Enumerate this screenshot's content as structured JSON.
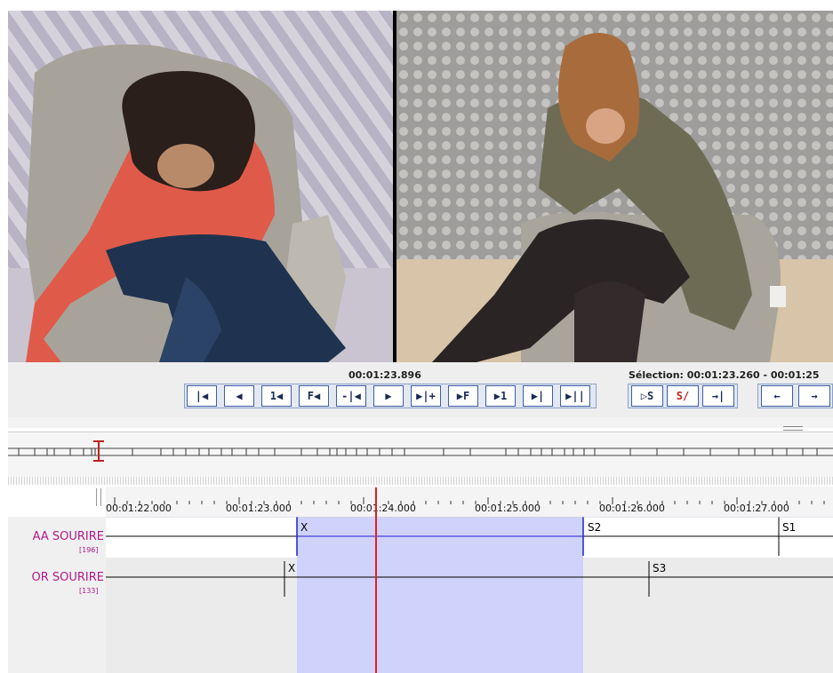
{
  "player": {
    "current_time": "00:01:23.896",
    "selection_label": "Sélection: 00:01:23.260 - 00:01:25"
  },
  "buttons": [
    {
      "id": "go-begin",
      "label": "|◀"
    },
    {
      "id": "prev-frame-step",
      "label": "◀"
    },
    {
      "id": "one-back",
      "label": "1◀"
    },
    {
      "id": "frame-back",
      "label": "F◀"
    },
    {
      "id": "prev-anno",
      "label": "-|◀"
    },
    {
      "id": "play",
      "label": "▶"
    },
    {
      "id": "next-anno",
      "label": "▶|+"
    },
    {
      "id": "frame-fwd",
      "label": "▶F"
    },
    {
      "id": "one-fwd",
      "label": "▶1"
    },
    {
      "id": "next-step",
      "label": "▶|"
    },
    {
      "id": "go-end",
      "label": "▶||"
    },
    {
      "id": "play-selection",
      "label": "▷S"
    },
    {
      "id": "clear-selection",
      "label": "S/"
    },
    {
      "id": "to-selection",
      "label": "→|"
    },
    {
      "id": "back",
      "label": "←"
    },
    {
      "id": "fwd",
      "label": "→"
    }
  ],
  "ruler": {
    "ticks": [
      "00:01:22.000",
      "00:01:23.000",
      "00:01:24.000",
      "00:01:25.000",
      "00:01:26.000",
      "00:01:27.000"
    ]
  },
  "tiers": [
    {
      "name": "AA SOURIRE",
      "count": "[196]"
    },
    {
      "name": "OR SOURIRE",
      "count": "[133]"
    }
  ],
  "annotations": {
    "tier1": [
      "X",
      "S2",
      "S1"
    ],
    "tier2": [
      "X",
      "S3"
    ]
  },
  "colors": {
    "selection": "#cfd2fa",
    "cursor": "#e02020",
    "tier_label": "#b0188a",
    "button_border": "#3b5fa8"
  }
}
